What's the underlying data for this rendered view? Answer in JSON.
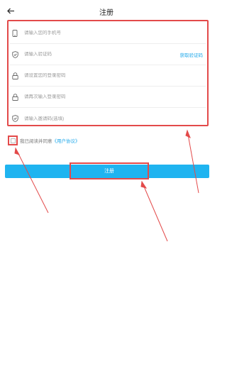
{
  "header": {
    "title": "注册",
    "back_icon": "arrow-left-icon"
  },
  "form": {
    "fields": [
      {
        "name": "phone",
        "icon": "phone-icon",
        "placeholder": "请输入您的手机号",
        "value": ""
      },
      {
        "name": "code",
        "icon": "shield-icon",
        "placeholder": "请输入验证码",
        "value": "",
        "action": "获取验证码"
      },
      {
        "name": "password",
        "icon": "lock-icon",
        "placeholder": "请设置您的登录密码",
        "value": ""
      },
      {
        "name": "password_confirm",
        "icon": "lock-icon",
        "placeholder": "请再次输入登录密码",
        "value": ""
      },
      {
        "name": "invite",
        "icon": "shield-icon",
        "placeholder": "请输入邀请码(选填)",
        "value": ""
      }
    ]
  },
  "agreement": {
    "text": "我已阅读并同意",
    "link": "《用户协议》",
    "checked": false
  },
  "submit": {
    "label": "注册"
  },
  "colors": {
    "accent": "#1fb4f0",
    "link": "#20a8ea",
    "annotation": "#e34a4a"
  }
}
